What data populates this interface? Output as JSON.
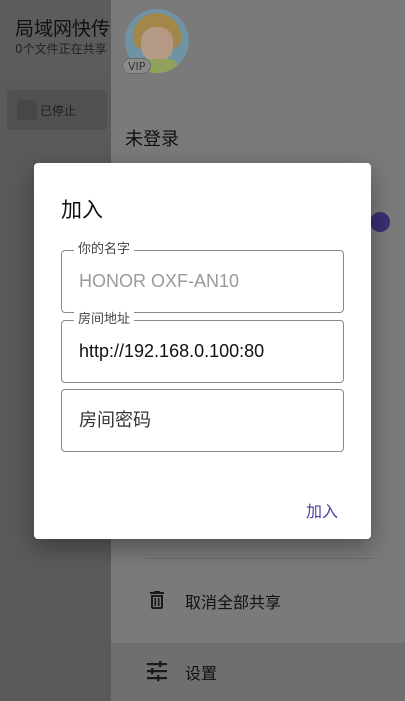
{
  "app": {
    "title": "局域网快传",
    "subtitle": "0个文件正在共享",
    "stopped_label": "已停止"
  },
  "drawer": {
    "vip_badge": "VIP",
    "login_status": "未登录",
    "items": [
      {
        "label": "取消全部共享",
        "icon": "trash-icon"
      },
      {
        "label": "设置",
        "icon": "sliders-icon"
      }
    ]
  },
  "dialog": {
    "title": "加入",
    "fields": {
      "name": {
        "label": "你的名字",
        "value": "HONOR OXF-AN10"
      },
      "address": {
        "label": "房间地址",
        "value": "http://192.168.0.100:80"
      },
      "password": {
        "placeholder": "房间密码",
        "value": ""
      }
    },
    "confirm_label": "加入"
  },
  "colors": {
    "accent": "#4b3fa0",
    "scrim": "#202020"
  }
}
